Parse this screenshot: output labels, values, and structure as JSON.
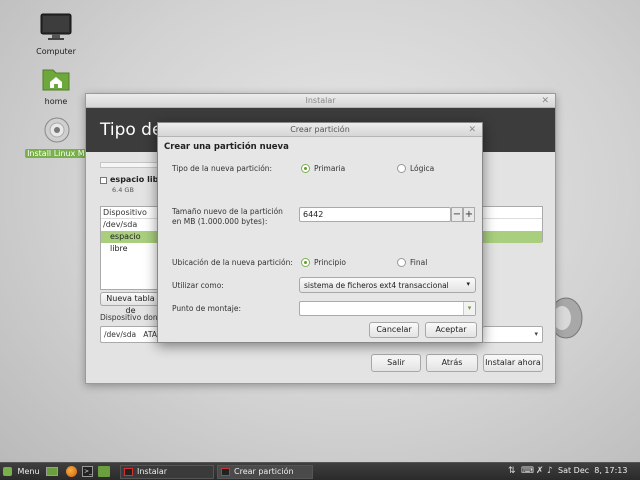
{
  "desktop": {
    "icons": [
      {
        "label": "Computer"
      },
      {
        "label": "home"
      },
      {
        "label": "Install Linux Mi"
      }
    ]
  },
  "installer": {
    "title": "Instalar",
    "header": "Tipo de i",
    "disk_checkbox_label": "espacio libr",
    "disk_size": "6.4 GB",
    "table_header": "Dispositivo",
    "rows": [
      "/dev/sda",
      "espacio libre"
    ],
    "new_table_button": "Nueva tabla de",
    "bootloader_label": "Dispositivo don",
    "bootloader_value": "/dev/sda   ATA",
    "buttons": {
      "quit": "Salir",
      "back": "Atrás",
      "install": "Instalar ahora"
    }
  },
  "dialog": {
    "title": "Crear partición",
    "heading": "Crear una partición nueva",
    "type_label": "Tipo de la nueva partición:",
    "type_primary": "Primaria",
    "type_logical": "Lógica",
    "size_label_1": "Tamaño nuevo de la partición",
    "size_label_2": "en MB (1.000.000 bytes):",
    "size_value": "6442",
    "location_label": "Ubicación de la nueva partición:",
    "location_start": "Principio",
    "location_end": "Final",
    "use_as_label": "Utilizar como:",
    "use_as_value": "sistema de ficheros ext4 transaccional",
    "mount_label": "Punto de montaje:",
    "mount_value": "",
    "cancel": "Cancelar",
    "accept": "Aceptar"
  },
  "taskbar": {
    "menu": "Menu",
    "tasks": [
      "Instalar",
      "Crear partición"
    ],
    "clock": "Sat Dec  8, 17:13"
  }
}
